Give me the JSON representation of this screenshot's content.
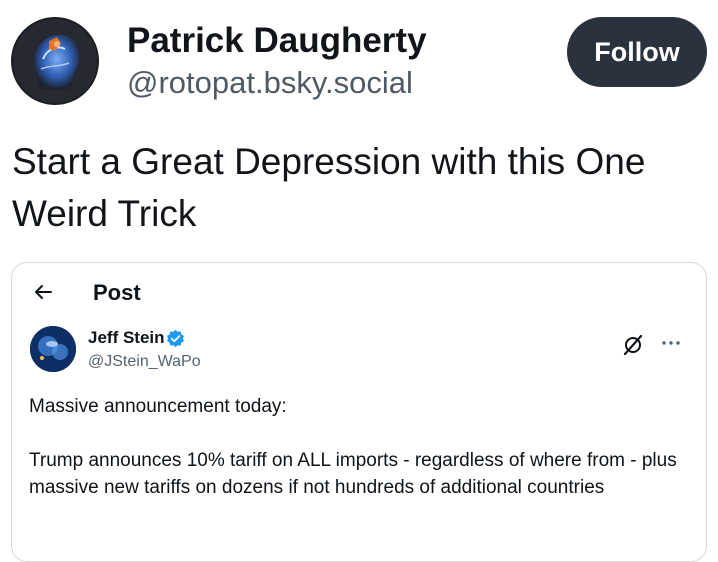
{
  "author": {
    "display_name": "Patrick Daugherty",
    "handle": "@rotopat.bsky.social",
    "avatar_icon": "brain-head-avatar"
  },
  "follow_label": "Follow",
  "post_text": "Start a Great Depression with this One Weird Trick",
  "embed": {
    "header_title": "Post",
    "back_icon": "back-arrow-icon",
    "quoted_author": {
      "name": "Jeff Stein",
      "handle": "@JStein_WaPo",
      "verified": true
    },
    "icons": [
      "grok-icon",
      "more-icon",
      "verified-badge-icon"
    ],
    "body_paragraphs": [
      "Massive announcement today:",
      "Trump announces 10% tariff on ALL imports - regardless of where from - plus massive new tariffs on dozens if not hundreds of additional countries"
    ]
  },
  "colors": {
    "follow_button_bg": "#2a333d",
    "verified_blue": "#1d9bf0",
    "handle_gray": "#4f5964"
  }
}
